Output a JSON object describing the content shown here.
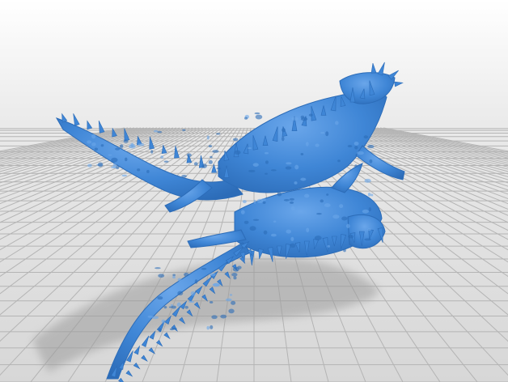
{
  "scene": {
    "subject": "3d-printable-thorny-devil-lizard-model",
    "background_top": "#ffffff",
    "background_horizon": "#e9e9e9",
    "floor_color": "#d7d7d7",
    "grid_line_color": "#b4b4b4",
    "shadow_color": "#9c9c9c",
    "model_color": "#3f86d6",
    "model_highlight": "#6aa6ea",
    "model_shade": "#2c6cb8"
  }
}
